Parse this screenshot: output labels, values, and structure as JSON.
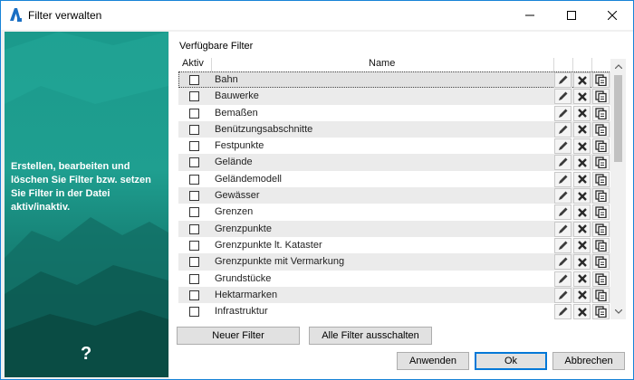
{
  "window": {
    "title": "Filter verwalten",
    "minimize_icon": "minimize-icon",
    "maximize_icon": "maximize-icon",
    "close_icon": "close-icon"
  },
  "sidebar": {
    "description": "Erstellen, bearbeiten und löschen Sie Filter bzw. setzen Sie Filter in der Datei aktiv/inaktiv.",
    "help_label": "?"
  },
  "filters": {
    "section_label": "Verfügbare Filter",
    "columns": {
      "active": "Aktiv",
      "name": "Name"
    },
    "rows": [
      {
        "name": "Bahn",
        "active": false
      },
      {
        "name": "Bauwerke",
        "active": false
      },
      {
        "name": "Bemaßen",
        "active": false
      },
      {
        "name": "Benützungsabschnitte",
        "active": false
      },
      {
        "name": "Festpunkte",
        "active": false
      },
      {
        "name": "Gelände",
        "active": false
      },
      {
        "name": "Geländemodell",
        "active": false
      },
      {
        "name": "Gewässer",
        "active": false
      },
      {
        "name": "Grenzen",
        "active": false
      },
      {
        "name": "Grenzpunkte",
        "active": false
      },
      {
        "name": "Grenzpunkte lt. Kataster",
        "active": false
      },
      {
        "name": "Grenzpunkte mit Vermarkung",
        "active": false
      },
      {
        "name": "Grundstücke",
        "active": false
      },
      {
        "name": "Hektarmarken",
        "active": false
      },
      {
        "name": "Infrastruktur",
        "active": false
      }
    ],
    "row_actions": [
      "edit-icon",
      "delete-icon",
      "copy-icon"
    ]
  },
  "buttons": {
    "new_filter": "Neuer Filter",
    "all_off": "Alle Filter ausschalten",
    "apply": "Anwenden",
    "ok": "Ok",
    "cancel": "Abbrechen"
  },
  "colors": {
    "accent": "#0078d7",
    "sidebar": "#1b9a8c"
  }
}
